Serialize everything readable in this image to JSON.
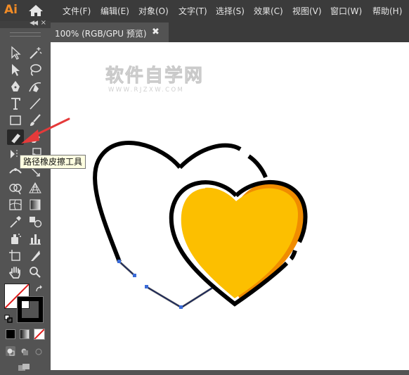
{
  "app": {
    "logo": "Ai"
  },
  "menu": [
    "文件(F)",
    "编辑(E)",
    "对象(O)",
    "文字(T)",
    "选择(S)",
    "效果(C)",
    "视图(V)",
    "窗口(W)",
    "帮助(H)"
  ],
  "document": {
    "tab_title": "100% (RGB/GPU 预览)",
    "close": "✖"
  },
  "tooltip": "路径橡皮擦工具",
  "watermark": {
    "main": "软件自学网",
    "sub": "WWW.RJZXW.COM"
  },
  "colors": {
    "fill": "#ffffff",
    "stroke": "#000000",
    "heart_fill": "#fcbf00",
    "heart_shadow": "#f08c00",
    "accent": "#f28c26"
  },
  "tools": [
    "selection-tool",
    "direct-selection-tool",
    "magic-wand-tool",
    "lasso-tool",
    "pen-tool",
    "curvature-tool",
    "type-tool",
    "line-segment-tool",
    "rectangle-tool",
    "paintbrush-tool",
    "path-eraser-tool",
    "eraser-tool",
    "rotate-tool",
    "scale-tool",
    "width-tool",
    "free-transform-tool",
    "shape-builder-tool",
    "perspective-grid-tool",
    "mesh-tool",
    "gradient-tool",
    "eyedropper-tool",
    "blend-tool",
    "symbol-sprayer-tool",
    "column-graph-tool",
    "artboard-tool",
    "slice-tool",
    "hand-tool",
    "zoom-tool"
  ]
}
